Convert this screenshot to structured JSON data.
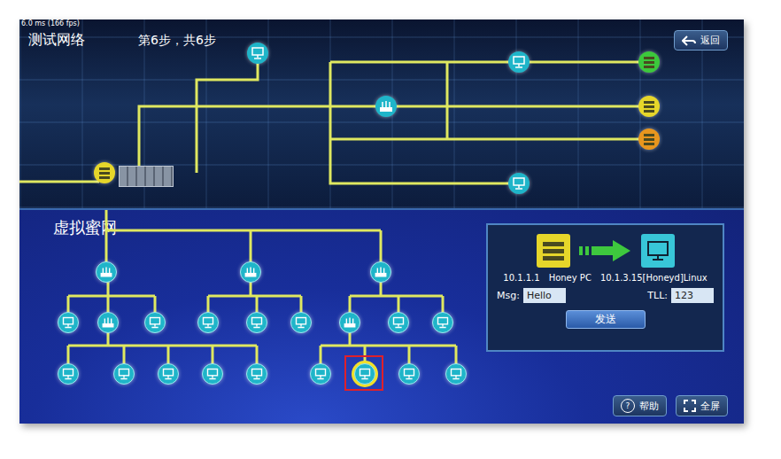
{
  "fps": "6.0 ms (166 fps)",
  "header": {
    "title": "测试网络",
    "step": "第6步，共6步",
    "back_button": "返回"
  },
  "network": {
    "nodes": [
      {
        "kind": "server",
        "color": "#e6d62a"
      },
      {
        "kind": "host",
        "color": "#1fb5c9"
      },
      {
        "kind": "router",
        "color": "#1fb5c9"
      },
      {
        "kind": "host",
        "color": "#1fb5c9"
      },
      {
        "kind": "server",
        "color": "#3cc83c"
      },
      {
        "kind": "server",
        "color": "#e6d62a"
      },
      {
        "kind": "server",
        "color": "#e8961e"
      },
      {
        "kind": "host",
        "color": "#1fb5c9"
      }
    ]
  },
  "honeynet": {
    "title": "虚拟蜜网",
    "nodes": [
      {
        "kind": "router",
        "selected": false
      },
      {
        "kind": "router",
        "selected": false
      },
      {
        "kind": "router",
        "selected": false
      },
      {
        "kind": "host",
        "selected": false
      },
      {
        "kind": "router",
        "selected": false
      },
      {
        "kind": "host",
        "selected": false
      },
      {
        "kind": "host",
        "selected": false
      },
      {
        "kind": "host",
        "selected": false
      },
      {
        "kind": "host",
        "selected": false
      },
      {
        "kind": "router",
        "selected": false
      },
      {
        "kind": "host",
        "selected": false
      },
      {
        "kind": "host",
        "selected": false
      },
      {
        "kind": "host",
        "selected": false
      },
      {
        "kind": "host",
        "selected": false
      },
      {
        "kind": "host",
        "selected": false
      },
      {
        "kind": "host",
        "selected": false
      },
      {
        "kind": "host",
        "selected": false
      },
      {
        "kind": "host",
        "selected": false
      },
      {
        "kind": "host",
        "selected": true
      },
      {
        "kind": "host",
        "selected": false
      },
      {
        "kind": "host",
        "selected": false
      }
    ]
  },
  "message_panel": {
    "source_ip": "10.1.1.1",
    "source_name": "Honey PC",
    "target_label": "10.1.3.15[Honeyd]Linux",
    "msg_label": "Msg:",
    "msg_value": "Hello",
    "ttl_label": "TLL:",
    "ttl_value": "123",
    "send_button": "发送"
  },
  "footer_buttons": [
    {
      "label": "帮助",
      "icon": "?",
      "kind": "help"
    },
    {
      "label": "全屏",
      "kind": "fullscreen"
    }
  ]
}
